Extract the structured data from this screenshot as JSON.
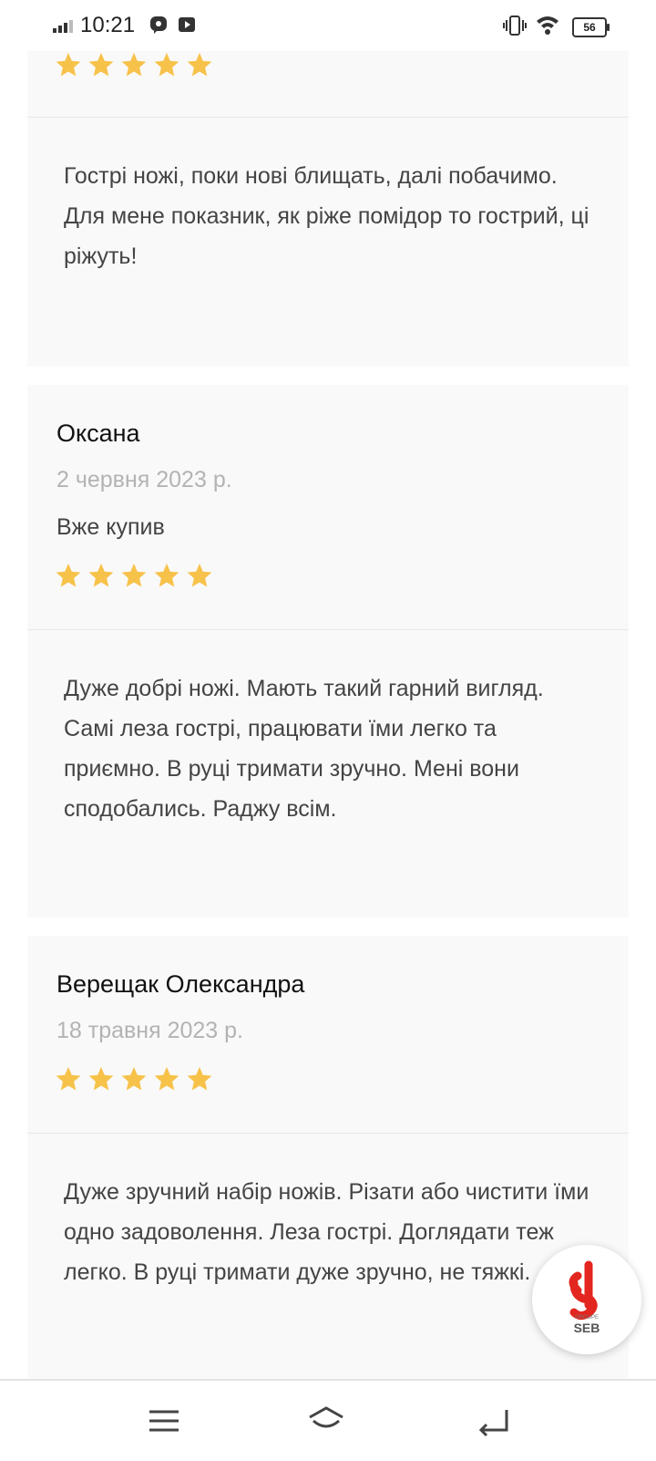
{
  "status_bar": {
    "time": "10:21",
    "battery": "56",
    "icons": [
      "signal-icon",
      "viber-icon",
      "youtube-icon",
      "vibrate-icon",
      "wifi-icon",
      "battery-icon"
    ]
  },
  "rating_color": "#f7c24a",
  "reviews": [
    {
      "stars": 5,
      "text": "Гострі ножі, поки нові блищать, далі побачимо. Для мене показник, як ріже помідор то гострий, ці ріжуть!"
    },
    {
      "author": "Оксана",
      "date": "2 червня 2023 р.",
      "tag": "Вже купив",
      "stars": 5,
      "text": "Дуже добрі ножі. Мають такий гарний вигляд. Самі леза гострі, працювати їми легко та приємно. В руці тримати зручно. Мені вони сподобались. Раджу всім."
    },
    {
      "author": "Верещак Олександра",
      "date": "18 травня 2023 р.",
      "stars": 5,
      "text": "Дуже зручний набір ножів. Різати або чистити їми одно задоволення. Леза гострі. Доглядати теж легко. В руці тримати дуже зручно, не тяжкі."
    }
  ],
  "fab": {
    "brand": "SEB",
    "sub": "GROUPE",
    "accent": "#e3261f"
  },
  "nav_bar": {
    "buttons": [
      "menu-icon",
      "home-icon",
      "back-icon"
    ]
  }
}
